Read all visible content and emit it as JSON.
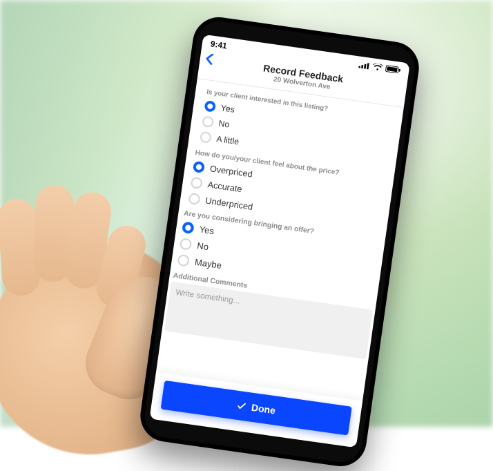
{
  "statusbar": {
    "time": "9:41"
  },
  "header": {
    "title": "Record Feedback",
    "subtitle": "20 Wolverton Ave"
  },
  "questions": [
    {
      "prompt": "Is your client interested in this listing?",
      "options": [
        "Yes",
        "No",
        "A little"
      ],
      "selected_index": 0
    },
    {
      "prompt": "How do you/your client feel about the price?",
      "options": [
        "Overpriced",
        "Accurate",
        "Underpriced"
      ],
      "selected_index": 0
    },
    {
      "prompt": "Are you considering bringing an offer?",
      "options": [
        "Yes",
        "No",
        "Maybe"
      ],
      "selected_index": 0
    }
  ],
  "comments": {
    "label": "Additional Comments",
    "placeholder": "Write something..."
  },
  "done": {
    "label": "Done"
  },
  "colors": {
    "accent": "#0b63ff",
    "primary_button": "#0b46ff"
  }
}
